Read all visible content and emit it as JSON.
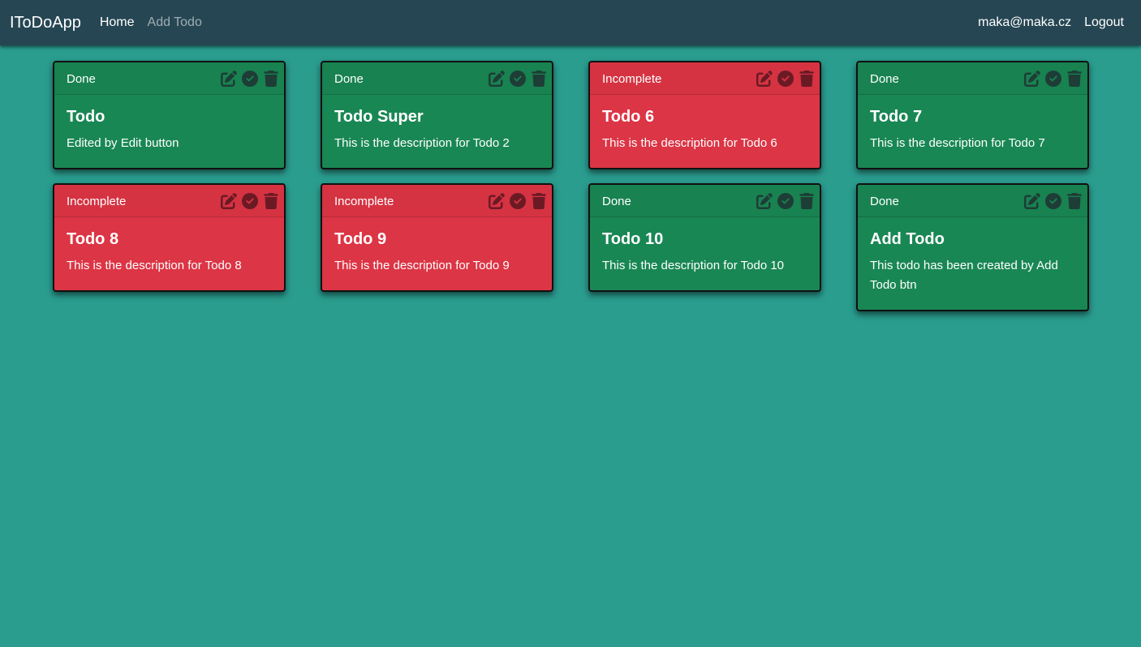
{
  "navbar": {
    "brand": "IToDoApp",
    "links": [
      "Home",
      "Add Todo"
    ],
    "user_email": "maka@maka.cz",
    "logout_label": "Logout"
  },
  "colors": {
    "page_background": "#2a9d8f",
    "navbar_background": "#264653",
    "done": "#198754",
    "incomplete": "#dc3545"
  },
  "todos": [
    {
      "status": "Done",
      "title": "Todo",
      "description": "Edited by Edit button"
    },
    {
      "status": "Done",
      "title": "Todo Super",
      "description": "This is the description for Todo 2"
    },
    {
      "status": "Incomplete",
      "title": "Todo 6",
      "description": "This is the description for Todo 6"
    },
    {
      "status": "Done",
      "title": "Todo 7",
      "description": "This is the description for Todo 7"
    },
    {
      "status": "Incomplete",
      "title": "Todo 8",
      "description": "This is the description for Todo 8"
    },
    {
      "status": "Incomplete",
      "title": "Todo 9",
      "description": "This is the description for Todo 9"
    },
    {
      "status": "Done",
      "title": "Todo 10",
      "description": "This is the description for Todo 10"
    },
    {
      "status": "Done",
      "title": "Add Todo",
      "description": "This todo has been created by Add Todo btn"
    }
  ],
  "card_icons": [
    "edit-icon",
    "check-circle-icon",
    "trash-icon"
  ]
}
